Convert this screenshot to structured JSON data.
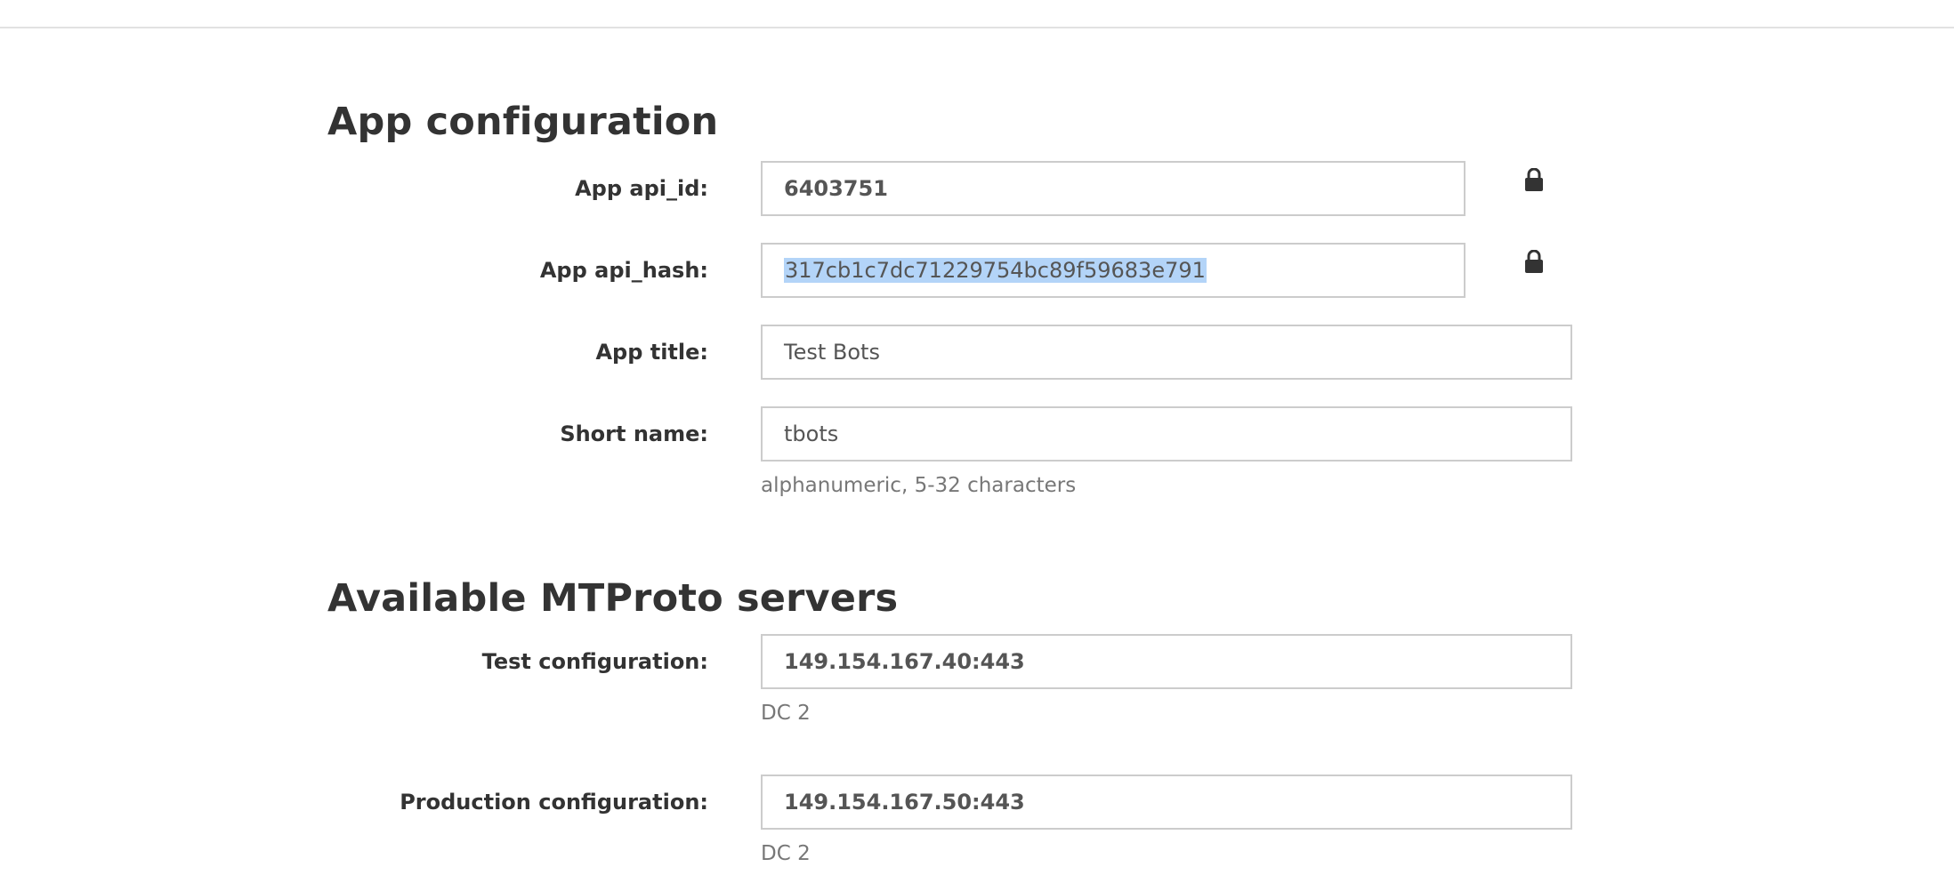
{
  "app_config": {
    "title": "App configuration",
    "api_id": {
      "label": "App api_id:",
      "value": "6403751"
    },
    "api_hash": {
      "label": "App api_hash:",
      "value": "317cb1c7dc71229754bc89f59683e791"
    },
    "app_title": {
      "label": "App title:",
      "value": "Test Bots"
    },
    "short_name": {
      "label": "Short name:",
      "value": "tbots",
      "hint": "alphanumeric, 5-32 characters"
    },
    "lock_icon": "lock-icon"
  },
  "servers": {
    "title": "Available MTProto servers",
    "test": {
      "label": "Test configuration:",
      "value": "149.154.167.40:443",
      "hint": "DC 2"
    },
    "production": {
      "label": "Production configuration:",
      "value": "149.154.167.50:443",
      "hint": "DC 2"
    }
  },
  "colors": {
    "selection": "#b3d4f8",
    "border": "#cccccc",
    "text": "#333333",
    "hint": "#777777"
  }
}
